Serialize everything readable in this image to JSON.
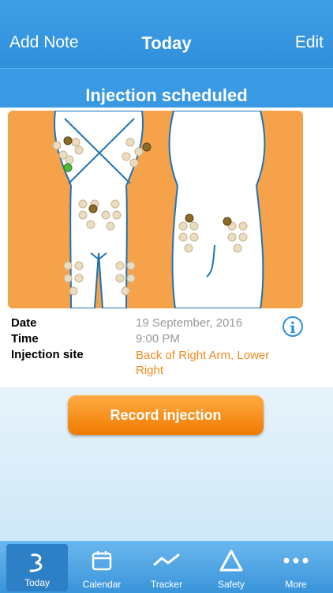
{
  "navbar": {
    "left_button": "Add Note",
    "title": "Today",
    "right_button": "Edit"
  },
  "banner": {
    "text": "Injection scheduled"
  },
  "details": {
    "date_label": "Date",
    "date_value": "19 September, 2016",
    "time_label": "Time",
    "time_value": "9:00 PM",
    "site_label": "Injection site",
    "site_value": "Back of Right Arm, Lower Right"
  },
  "record_button": "Record injection",
  "tabs": [
    {
      "label": "Today",
      "icon": "today-icon",
      "active": true
    },
    {
      "label": "Calendar",
      "icon": "calendar-icon",
      "active": false
    },
    {
      "label": "Tracker",
      "icon": "tracker-icon",
      "active": false
    },
    {
      "label": "Safety",
      "icon": "safety-icon",
      "active": false
    },
    {
      "label": "More",
      "icon": "more-icon",
      "active": false
    }
  ],
  "colors": {
    "nav_blue": "#2f8fdc",
    "orange": "#ef8a1f",
    "body_bg": "#f5a04b"
  }
}
